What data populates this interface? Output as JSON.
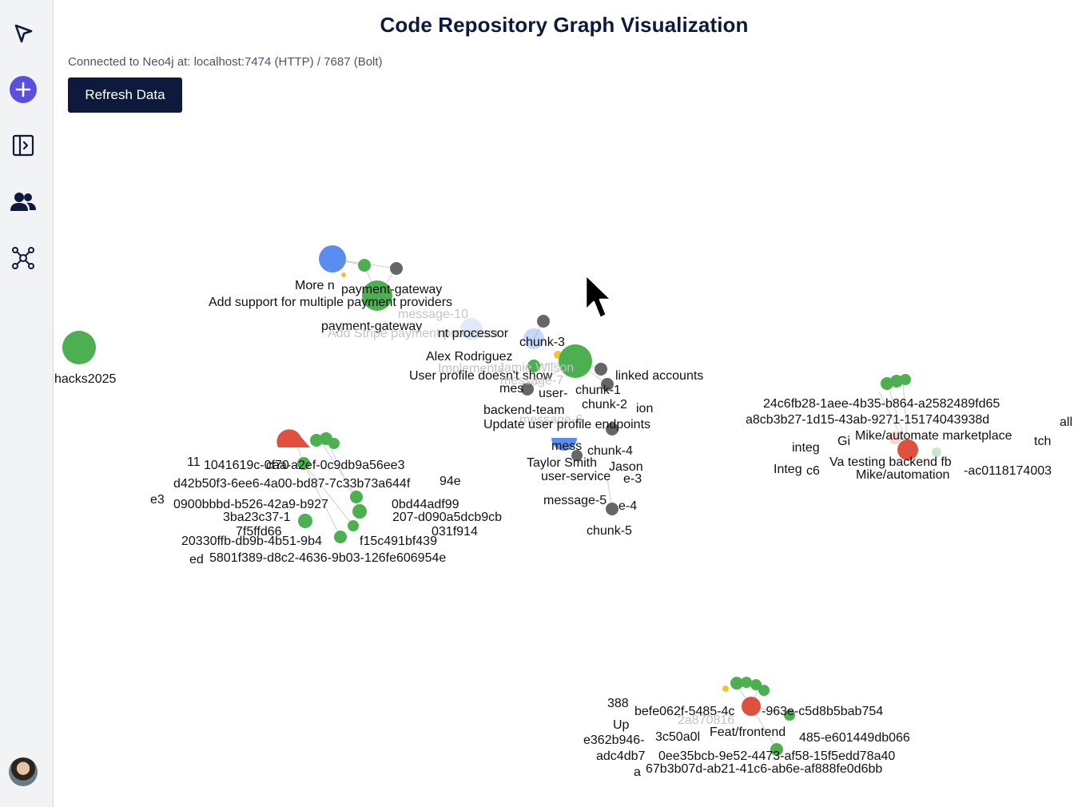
{
  "app": {
    "title": "Code Repository Graph Visualization",
    "connection_status": "Connected to Neo4j at: localhost:7474 (HTTP) / 7687 (Bolt)",
    "refresh_label": "Refresh Data"
  },
  "sidebar": {
    "items": [
      {
        "icon": "select-arrow-icon"
      },
      {
        "icon": "add-icon",
        "color": "#5b4fe0"
      },
      {
        "icon": "panel-toggle-icon"
      },
      {
        "icon": "users-icon"
      },
      {
        "icon": "graph-icon"
      }
    ]
  },
  "colors": {
    "green": "#4caf50",
    "blue": "#5b8def",
    "red": "#e05040",
    "gray": "#666666",
    "yellow": "#f4c430",
    "navy": "#0e1a3b"
  },
  "graph": {
    "labels": [
      {
        "text": "hacks2025",
        "color": "dark"
      },
      {
        "text": "More n",
        "color": "dark"
      },
      {
        "text": "payment-gateway",
        "color": "dark"
      },
      {
        "text": "Add support for multiple payment providers",
        "color": "dark"
      },
      {
        "text": "message-10",
        "color": "faint"
      },
      {
        "text": "payment-gateway",
        "color": "dark"
      },
      {
        "text": "Add Stripe payment processor",
        "color": "faint"
      },
      {
        "text": "nt processor",
        "color": "dark"
      },
      {
        "text": "chunk-3",
        "color": "dark"
      },
      {
        "text": "Alex Rodriguez",
        "color": "dark"
      },
      {
        "text": "Implements",
        "color": "faint"
      },
      {
        "text": "Jamie Wilson",
        "color": "faint"
      },
      {
        "text": "User profile doesn't show",
        "color": "dark"
      },
      {
        "text": "linked accounts",
        "color": "dark"
      },
      {
        "text": "message-7",
        "color": "faint"
      },
      {
        "text": "chunk-1",
        "color": "dark"
      },
      {
        "text": "mes",
        "color": "dark"
      },
      {
        "text": "user-",
        "color": "dark"
      },
      {
        "text": "backend-team",
        "color": "dark"
      },
      {
        "text": "chunk-2",
        "color": "dark"
      },
      {
        "text": "ion",
        "color": "dark"
      },
      {
        "text": "message-6",
        "color": "faint"
      },
      {
        "text": "Update user profile endpoints",
        "color": "dark"
      },
      {
        "text": "mess",
        "color": "dark"
      },
      {
        "text": "chunk-4",
        "color": "dark"
      },
      {
        "text": "Taylor Smith",
        "color": "dark"
      },
      {
        "text": "Jason",
        "color": "dark"
      },
      {
        "text": "user-service",
        "color": "dark"
      },
      {
        "text": "e-3",
        "color": "dark"
      },
      {
        "text": "message-5",
        "color": "dark"
      },
      {
        "text": "e-4",
        "color": "dark"
      },
      {
        "text": "chunk-5",
        "color": "dark"
      },
      {
        "text": "11",
        "color": "dark"
      },
      {
        "text": "1041619c-0f70",
        "color": "dark"
      },
      {
        "text": "caa-a2ef-0c9db9a56ee3",
        "color": "dark"
      },
      {
        "text": "d42b50f3-6ee6-4a00-bd87-7c33b73a644f",
        "color": "dark"
      },
      {
        "text": "94e",
        "color": "dark"
      },
      {
        "text": "e3",
        "color": "dark"
      },
      {
        "text": "0900bbbd-b526-42a9-b927",
        "color": "dark"
      },
      {
        "text": "0bd44adf99",
        "color": "dark"
      },
      {
        "text": "3ba23c37-1",
        "color": "dark"
      },
      {
        "text": "207-d090a5dcb9cb",
        "color": "dark"
      },
      {
        "text": "7f5ffd66",
        "color": "dark"
      },
      {
        "text": "031f914",
        "color": "dark"
      },
      {
        "text": "20330ffb-db9b-4b51-9b4",
        "color": "dark"
      },
      {
        "text": "f15c491bf439",
        "color": "dark"
      },
      {
        "text": "ed",
        "color": "dark"
      },
      {
        "text": "5801f389-d8c2-4636-9b03-126fe606954e",
        "color": "dark"
      },
      {
        "text": "24c6fb28-1aee-4b35-b864-a2582489fd65",
        "color": "dark"
      },
      {
        "text": "a8cb3b27-1d15-43ab-9271-15174043938d",
        "color": "dark"
      },
      {
        "text": "all",
        "color": "dark"
      },
      {
        "text": "integ",
        "color": "dark"
      },
      {
        "text": "Gi",
        "color": "dark"
      },
      {
        "text": "Mike/automate marketplace",
        "color": "dark"
      },
      {
        "text": "tch",
        "color": "dark"
      },
      {
        "text": "Va testing backend fb",
        "color": "dark"
      },
      {
        "text": "Integ",
        "color": "dark"
      },
      {
        "text": "c6",
        "color": "dark"
      },
      {
        "text": "Mike/automation",
        "color": "dark"
      },
      {
        "text": "-ac0118174003",
        "color": "dark"
      },
      {
        "text": "388",
        "color": "dark"
      },
      {
        "text": "befe062f-5485-4c",
        "color": "dark"
      },
      {
        "text": "-963e-c5d8b5bab754",
        "color": "dark"
      },
      {
        "text": "Up",
        "color": "dark"
      },
      {
        "text": "2a870816",
        "color": "faint"
      },
      {
        "text": "e362b946-",
        "color": "dark"
      },
      {
        "text": "3c50a0l",
        "color": "dark"
      },
      {
        "text": "Feat/frontend",
        "color": "dark"
      },
      {
        "text": "485-e601449db066",
        "color": "dark"
      },
      {
        "text": "adc4db7",
        "color": "dark"
      },
      {
        "text": "0ee35bcb-9e52-4473-af58-15f5edd78a40",
        "color": "dark"
      },
      {
        "text": "a",
        "color": "dark"
      },
      {
        "text": "67b3b07d-ab21-41c6-ab6e-af888fe0d6bb",
        "color": "dark"
      }
    ]
  }
}
